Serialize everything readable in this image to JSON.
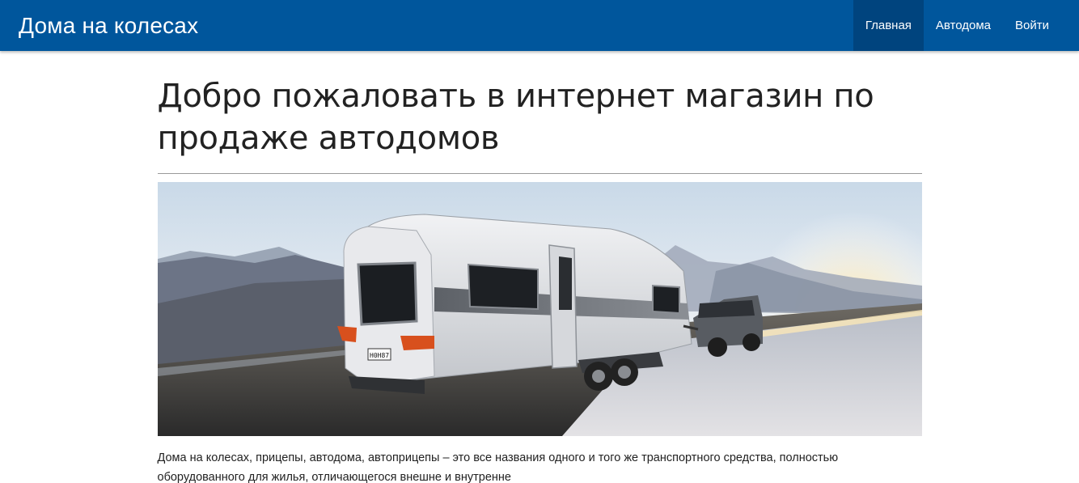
{
  "navbar": {
    "brand": "Дома на колесах",
    "items": [
      {
        "label": "Главная",
        "active": true
      },
      {
        "label": "Автодома",
        "active": false
      },
      {
        "label": "Войти",
        "active": false
      }
    ]
  },
  "main": {
    "heading": "Добро пожаловать в интернет магазин по продаже автодомов",
    "hero_image": "caravan-towed-by-suv-on-winter-mountain-road",
    "caravan_plate": "H0H87",
    "paragraph": "Дома на колесах, прицепы, автодома, автоприцепы – это все названия одного и того же транспортного средства, полностью оборудованного для жилья, отличающегося внешне и внутренне"
  },
  "colors": {
    "navbar_bg": "#00569c",
    "nav_active_bg": "#00447e",
    "text": "#222222"
  }
}
